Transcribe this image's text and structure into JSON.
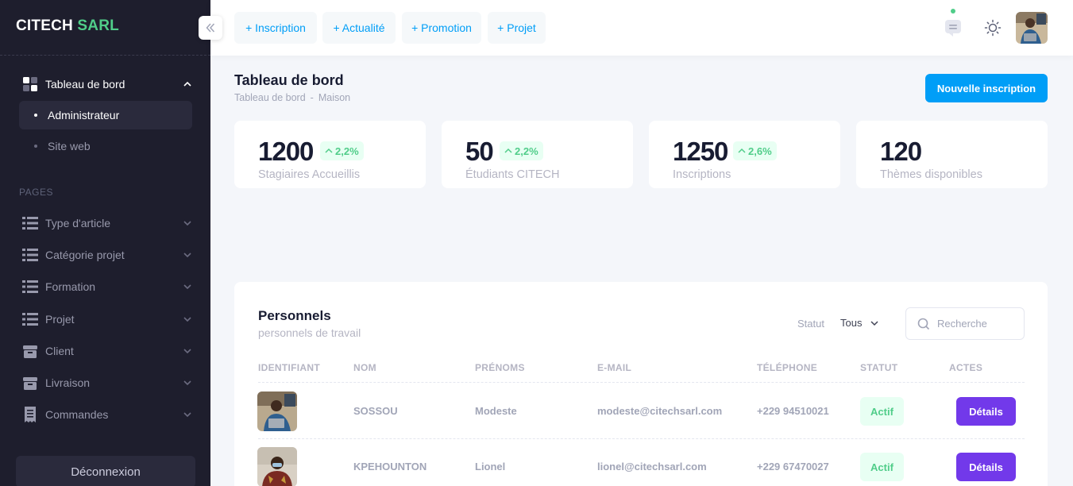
{
  "brand": {
    "name": "CITECH",
    "accent": "SARL"
  },
  "sidebar": {
    "dashboard": {
      "label": "Tableau de bord",
      "icon": "dashboard-grid-icon"
    },
    "sub_items": [
      {
        "label": "Administrateur",
        "active": true
      },
      {
        "label": "Site web",
        "active": false
      }
    ],
    "section_label": "PAGES",
    "items": [
      {
        "label": "Type d'article",
        "icon": "list-icon"
      },
      {
        "label": "Catégorie projet",
        "icon": "list-icon"
      },
      {
        "label": "Formation",
        "icon": "list-icon"
      },
      {
        "label": "Projet",
        "icon": "list-icon"
      },
      {
        "label": "Client",
        "icon": "box-icon"
      },
      {
        "label": "Livraison",
        "icon": "box-icon"
      },
      {
        "label": "Commandes",
        "icon": "receipt-icon"
      }
    ],
    "logout_label": "Déconnexion"
  },
  "header": {
    "quick_actions": [
      "+ Inscription",
      "+ Actualité",
      "+ Promotion",
      "+ Projet"
    ],
    "icons": [
      "chat-icon",
      "sun-icon",
      "user-avatar"
    ]
  },
  "toolbar": {
    "title": "Tableau de bord",
    "breadcrumb": [
      "Tableau de bord",
      "-",
      "Maison"
    ],
    "primary_button": "Nouvelle inscription"
  },
  "stats": [
    {
      "value": "1200",
      "trend": "2,2%",
      "label": "Stagiaires Accueillis"
    },
    {
      "value": "50",
      "trend": "2,2%",
      "label": "Étudiants CITECH"
    },
    {
      "value": "1250",
      "trend": "2,6%",
      "label": "Inscriptions"
    },
    {
      "value": "120",
      "trend": "",
      "label": "Thèmes disponibles"
    }
  ],
  "personnel": {
    "title": "Personnels",
    "subtitle": "personnels de travail",
    "filter_label": "Statut",
    "filter_value": "Tous",
    "search_placeholder": "Recherche",
    "columns": [
      "IDENTIFIANT",
      "NOM",
      "PRÉNOMS",
      "E-MAIL",
      "TÉLÉPHONE",
      "STATUT",
      "ACTES"
    ],
    "rows": [
      {
        "nom": "SOSSOU",
        "prenoms": "Modeste",
        "email": "modeste@citechsarl.com",
        "telephone": "+229 94510021",
        "statut": "Actif",
        "action": "Détails"
      },
      {
        "nom": "KPEHOUNTON",
        "prenoms": "Lionel",
        "email": "lionel@citechsarl.com",
        "telephone": "+229 67470027",
        "statut": "Actif",
        "action": "Détails"
      }
    ]
  },
  "colors": {
    "sidebar_bg": "#1e1e2d",
    "primary": "#009ef7",
    "success": "#50cd89",
    "purple": "#7239ea"
  }
}
